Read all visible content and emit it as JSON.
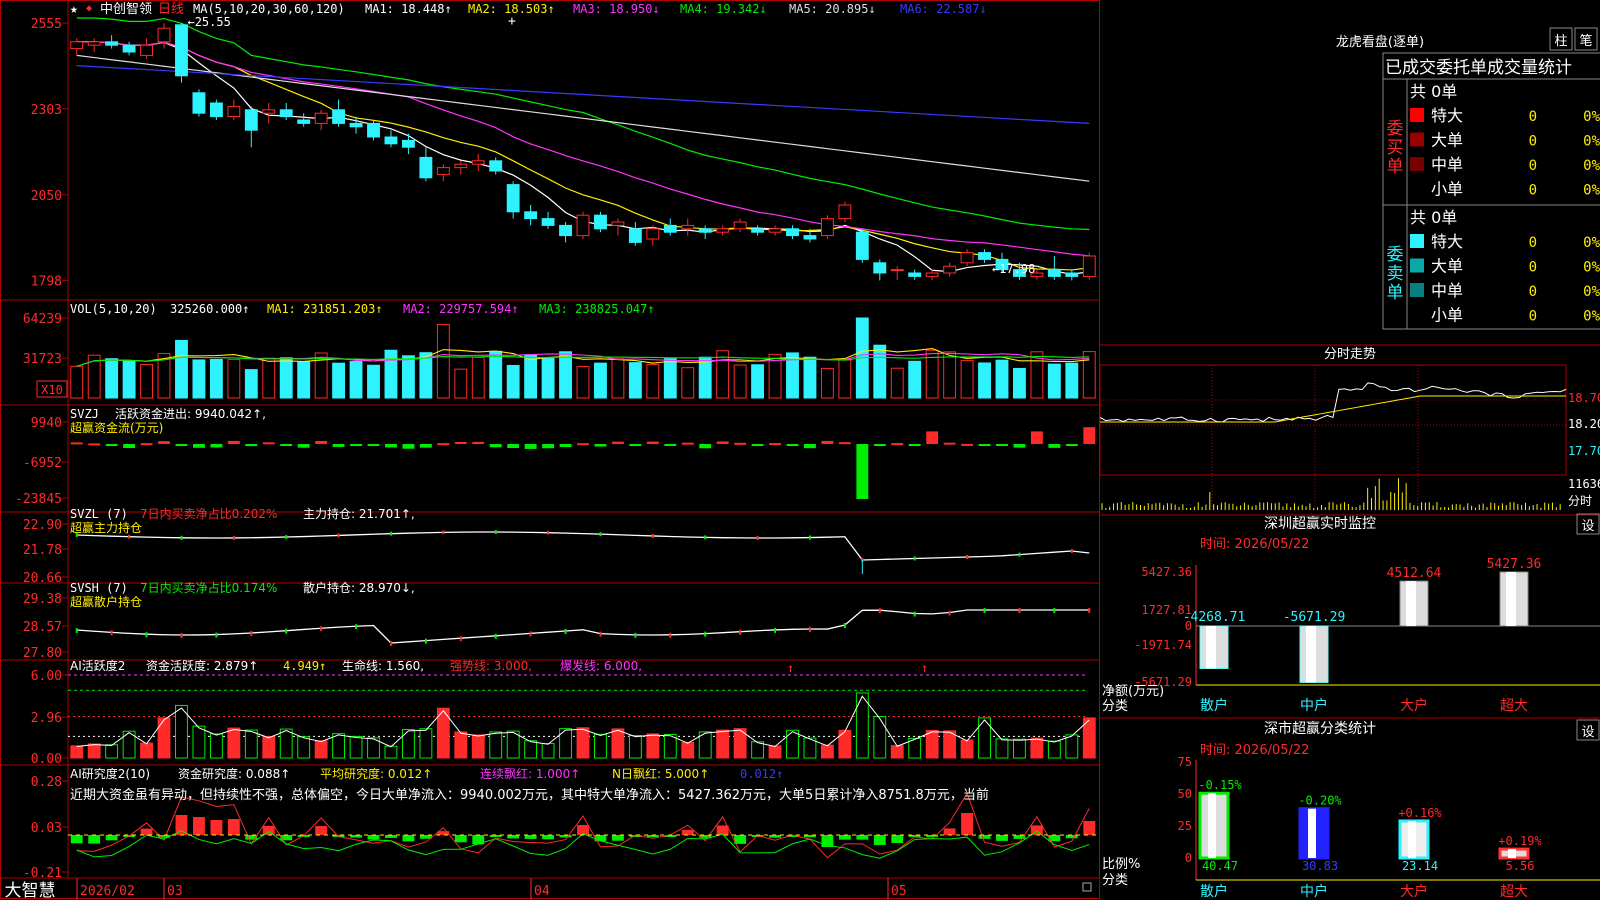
{
  "colors": {
    "up": "#ff2a2a",
    "down": "#2ef3ff",
    "green": "#00ee00",
    "yellow": "#ffee00",
    "magenta": "#ff33ff",
    "gray": "#dddddd",
    "blue": "#3a3aff",
    "border": "#b00000",
    "white": "#ffffff"
  },
  "main": {
    "star": "★",
    "stock_name": "中创智领",
    "period": "日线",
    "ma_label": "MA(5,10,20,30,60,120)",
    "ma": [
      {
        "label": "MA1: 18.448↑",
        "color": "#ffffff"
      },
      {
        "label": "MA2: 18.503↑",
        "color": "#ffee00"
      },
      {
        "label": "MA3: 18.950↓",
        "color": "#ff33ff"
      },
      {
        "label": "MA4: 19.342↓",
        "color": "#00ee00"
      },
      {
        "label": "MA5: 20.895↓",
        "color": "#dddddd"
      },
      {
        "label": "MA6: 22.587↓",
        "color": "#3a3aff"
      }
    ],
    "high_mark": "←25.55",
    "low_mark": "←17.98",
    "y_ticks": [
      "2555",
      "2303",
      "2050",
      "1798"
    ]
  },
  "vol": {
    "title": "VOL(5,10,20)",
    "value": "325260.000↑",
    "ma1": "MA1: 231851.203↑",
    "ma2": "MA2: 229757.594↑",
    "ma3": "MA3: 238825.047↑",
    "y_ticks": [
      "64239",
      "31723"
    ],
    "unit": "X10"
  },
  "svzj": {
    "title": "SVZJ",
    "label": "活跃资金进出: 9940.042↑,",
    "subtitle": "超赢资金流(万元)",
    "y_ticks": [
      "9940",
      "-6952",
      "-23845"
    ]
  },
  "svzl": {
    "title": "SVZL (7)",
    "pct_label": "7日内买卖净占比0.202%",
    "main_label": "主力持仓: 21.701↑,",
    "subtitle": "超赢主力持仓",
    "y_ticks": [
      "22.90",
      "21.78",
      "20.66"
    ]
  },
  "svsh": {
    "title": "SVSH (7)",
    "pct_label": "7日内买卖净占比0.174%",
    "main_label": "散户持仓: 28.970↓,",
    "subtitle": "超赢散户持仓",
    "y_ticks": [
      "29.38",
      "28.57",
      "27.80"
    ]
  },
  "ai1": {
    "title": "AI活跃度2",
    "a": "资金活跃度: 2.879↑",
    "b": "4.949↑",
    "c": "生命线: 1.560,",
    "d": "强势线: 3.000,",
    "e": "爆发线: 6.000,",
    "y_ticks": [
      "6.00",
      "2.96",
      "0.00"
    ]
  },
  "ai2": {
    "title": "AI研究度2(10)",
    "a": "资金研究度: 0.088↑",
    "b": "平均研究度: 0.012↑",
    "c": "连续飘红: 1.000↑",
    "d": "N日飘红: 5.000↑",
    "e": "0.012↑",
    "comment": "近期大资金虽有异动，但持续性不强，总体偏空，今日大单净流入：9940.002万元，其中特大单净流入：5427.362万元，大单5日累计净入8751.8万元，当前",
    "y_ticks": [
      "0.28",
      "0.03",
      "-0.21"
    ]
  },
  "xaxis": {
    "labels": [
      "2026/02",
      "03",
      "04",
      "05"
    ]
  },
  "brand": "大智慧",
  "dragon": {
    "title": "龙虎看盘(逐单)",
    "btn1": "柱",
    "btn2": "笔",
    "header": "已成交委托单成交量统计",
    "buy": {
      "side": "委买单",
      "total": "共 0单",
      "rows": [
        {
          "name": "特大",
          "v": "0",
          "p": "0%",
          "c": "#ff0000"
        },
        {
          "name": "大单",
          "v": "0",
          "p": "0%",
          "c": "#990000"
        },
        {
          "name": "中单",
          "v": "0",
          "p": "0%",
          "c": "#770000"
        },
        {
          "name": "小单",
          "v": "0",
          "p": "0%",
          "c": ""
        }
      ]
    },
    "sell": {
      "side": "委卖单",
      "total": "共 0单",
      "rows": [
        {
          "name": "特大",
          "v": "0",
          "p": "0%",
          "c": "#2ef3ff"
        },
        {
          "name": "大单",
          "v": "0",
          "p": "0%",
          "c": "#0aa8a8"
        },
        {
          "name": "中单",
          "v": "0",
          "p": "0%",
          "c": "#088080"
        },
        {
          "name": "小单",
          "v": "0",
          "p": "0%",
          "c": ""
        }
      ]
    }
  },
  "minute": {
    "title": "分时走势",
    "y_ticks": [
      "18.70",
      "18.20",
      "17.70"
    ],
    "vol_tick": "11636",
    "unit": "分时"
  },
  "monitor": {
    "title": "深圳超赢实时监控",
    "btn": "设",
    "date": "时间: 2026/05/22",
    "y_ticks": [
      "5427.36",
      "1727.81",
      "0",
      "-1971.74",
      "-5671.29"
    ],
    "ylabel": "净额(万元)",
    "xcat": "分类",
    "bars": [
      {
        "name": "散户",
        "value": "-4268.71"
      },
      {
        "name": "中户",
        "value": "-5671.29"
      },
      {
        "name": "大户",
        "value": "4512.64"
      },
      {
        "name": "超大",
        "value": "5427.36"
      }
    ]
  },
  "classstat": {
    "title": "深市超赢分类统计",
    "btn": "设",
    "date": "时间: 2026/05/22",
    "y_ticks": [
      "75",
      "50",
      "25",
      "0"
    ],
    "ylabel": "比例%",
    "xcat": "分类",
    "bars": [
      {
        "name": "散户",
        "pct": "40.47",
        "chg": "-0.15%"
      },
      {
        "name": "中户",
        "pct": "30.83",
        "chg": "-0.20%"
      },
      {
        "name": "大户",
        "pct": "23.14",
        "chg": "+0.16%"
      },
      {
        "name": "超大",
        "pct": "5.56",
        "chg": "+0.19%"
      }
    ]
  },
  "chart_data": {
    "type": "candlestick",
    "ohlc": [
      [
        24.8,
        25.1,
        24.6,
        25.0
      ],
      [
        24.9,
        25.1,
        24.7,
        25.0
      ],
      [
        25.0,
        25.2,
        24.8,
        24.9
      ],
      [
        24.9,
        25.0,
        24.6,
        24.7
      ],
      [
        24.6,
        25.1,
        24.5,
        24.9
      ],
      [
        25.0,
        25.55,
        24.8,
        25.4
      ],
      [
        25.5,
        25.55,
        23.8,
        24.0
      ],
      [
        23.5,
        23.6,
        22.8,
        22.9
      ],
      [
        23.2,
        23.3,
        22.7,
        22.8
      ],
      [
        22.8,
        23.3,
        22.7,
        23.1
      ],
      [
        23.0,
        23.1,
        21.9,
        22.4
      ],
      [
        22.9,
        23.2,
        22.6,
        23.0
      ],
      [
        23.0,
        23.2,
        22.7,
        22.8
      ],
      [
        22.7,
        22.9,
        22.5,
        22.6
      ],
      [
        22.6,
        23.0,
        22.4,
        22.9
      ],
      [
        23.0,
        23.3,
        22.5,
        22.6
      ],
      [
        22.6,
        22.8,
        22.3,
        22.5
      ],
      [
        22.6,
        22.7,
        22.1,
        22.2
      ],
      [
        22.2,
        22.4,
        21.9,
        22.0
      ],
      [
        22.1,
        22.3,
        21.7,
        21.9
      ],
      [
        21.6,
        21.9,
        20.9,
        21.0
      ],
      [
        21.1,
        21.4,
        20.9,
        21.3
      ],
      [
        21.3,
        21.5,
        21.1,
        21.4
      ],
      [
        21.4,
        21.7,
        21.2,
        21.5
      ],
      [
        21.5,
        21.6,
        21.1,
        21.2
      ],
      [
        20.8,
        20.9,
        19.8,
        20.0
      ],
      [
        20.0,
        20.2,
        19.6,
        19.8
      ],
      [
        19.8,
        20.0,
        19.5,
        19.6
      ],
      [
        19.6,
        19.7,
        19.1,
        19.3
      ],
      [
        19.3,
        20.0,
        19.2,
        19.9
      ],
      [
        19.9,
        20.0,
        19.4,
        19.5
      ],
      [
        19.6,
        19.8,
        19.3,
        19.7
      ],
      [
        19.5,
        19.7,
        19.0,
        19.1
      ],
      [
        19.2,
        19.6,
        19.0,
        19.5
      ],
      [
        19.6,
        19.8,
        19.3,
        19.4
      ],
      [
        19.5,
        19.8,
        19.3,
        19.6
      ],
      [
        19.5,
        19.6,
        19.2,
        19.4
      ],
      [
        19.4,
        19.6,
        19.3,
        19.5
      ],
      [
        19.5,
        19.8,
        19.4,
        19.7
      ],
      [
        19.5,
        19.6,
        19.3,
        19.4
      ],
      [
        19.4,
        19.6,
        19.3,
        19.5
      ],
      [
        19.5,
        19.6,
        19.2,
        19.3
      ],
      [
        19.3,
        19.5,
        19.1,
        19.2
      ],
      [
        19.3,
        19.9,
        19.2,
        19.8
      ],
      [
        19.8,
        20.3,
        19.7,
        20.2
      ],
      [
        19.4,
        19.5,
        18.5,
        18.6
      ],
      [
        18.5,
        18.6,
        17.98,
        18.2
      ],
      [
        18.3,
        18.4,
        18.0,
        18.3
      ],
      [
        18.2,
        18.3,
        18.0,
        18.1
      ],
      [
        18.1,
        18.3,
        17.99,
        18.2
      ],
      [
        18.2,
        18.5,
        18.1,
        18.4
      ],
      [
        18.5,
        18.9,
        18.4,
        18.8
      ],
      [
        18.8,
        18.9,
        18.5,
        18.6
      ],
      [
        18.6,
        18.8,
        18.2,
        18.3
      ],
      [
        18.3,
        18.5,
        18.0,
        18.1
      ],
      [
        18.1,
        18.3,
        18.0,
        18.2
      ],
      [
        18.3,
        18.7,
        18.0,
        18.1
      ],
      [
        18.2,
        18.3,
        17.98,
        18.1
      ],
      [
        18.1,
        18.8,
        18.0,
        18.7
      ]
    ]
  }
}
